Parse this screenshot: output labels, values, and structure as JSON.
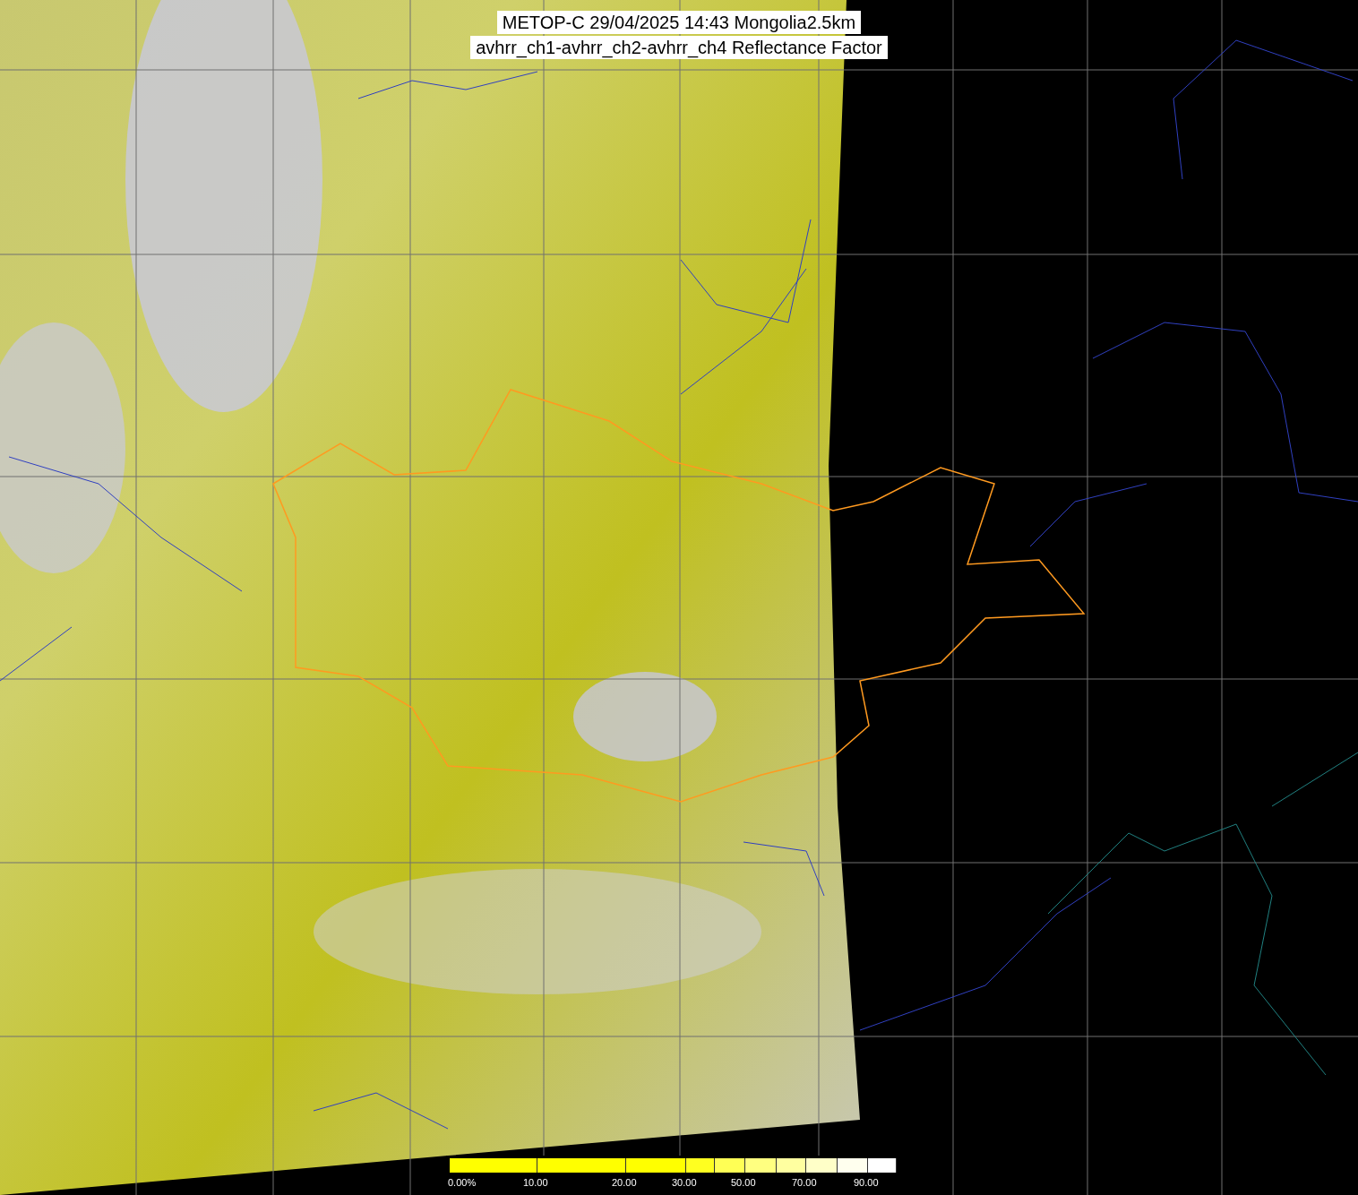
{
  "title": {
    "lines": [
      "METOP-C 29/04/2025 14:43 Mongolia2.5km",
      "avhrr_ch1-avhrr_ch2-avhrr_ch4 Reflectance Factor"
    ]
  },
  "colorbar": {
    "segments": [
      {
        "color": "#ffff00"
      },
      {
        "color": "#ffff00"
      },
      {
        "color": "#ffff00"
      },
      {
        "color": "#ffff20"
      },
      {
        "color": "#ffff55"
      },
      {
        "color": "#ffff80"
      },
      {
        "color": "#ffffa0"
      },
      {
        "color": "#ffffc8"
      },
      {
        "color": "#ffffee"
      },
      {
        "color": "#ffffff"
      }
    ],
    "labels": [
      "0.00%",
      "10.00",
      "20.00",
      "30.00",
      "50.00",
      "70.00",
      "90.00"
    ]
  }
}
